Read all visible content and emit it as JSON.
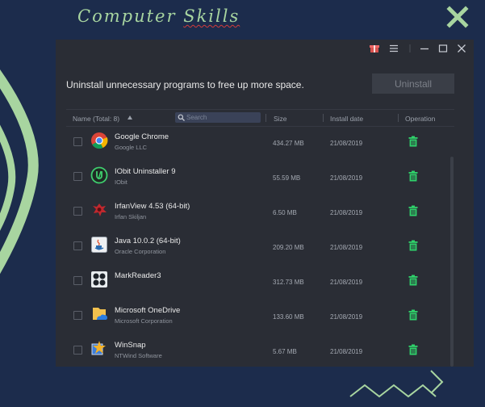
{
  "decor": {
    "title_part1": "Computer ",
    "title_part2": "Skills"
  },
  "window": {
    "headline": "Uninstall unnecessary programs to free up more space.",
    "uninstall_label": "Uninstall",
    "titlebar_icons": [
      "gift-icon",
      "menu-icon",
      "minimize-icon",
      "maximize-icon",
      "close-icon"
    ]
  },
  "columns": {
    "name": "Name (Total: 8)",
    "search_placeholder": "Search",
    "size": "Size",
    "date": "Install date",
    "operation": "Operation"
  },
  "apps": [
    {
      "name": "Google Chrome",
      "publisher": "Google LLC",
      "size": "434.27 MB",
      "date": "21/08/2019",
      "icon": "chrome-icon"
    },
    {
      "name": "IObit Uninstaller 9",
      "publisher": "IObit",
      "size": "55.59 MB",
      "date": "21/08/2019",
      "icon": "iobit-uninstaller-icon"
    },
    {
      "name": "IrfanView 4.53 (64-bit)",
      "publisher": "Irfan Skiljan",
      "size": "6.50 MB",
      "date": "21/08/2019",
      "icon": "irfanview-icon"
    },
    {
      "name": "Java 10.0.2 (64-bit)",
      "publisher": "Oracle Corporation",
      "size": "209.20 MB",
      "date": "21/08/2019",
      "icon": "java-icon"
    },
    {
      "name": "MarkReader3",
      "publisher": "",
      "size": "312.73 MB",
      "date": "21/08/2019",
      "icon": "markreader-icon"
    },
    {
      "name": "Microsoft OneDrive",
      "publisher": "Microsoft Corporation",
      "size": "133.60 MB",
      "date": "21/08/2019",
      "icon": "onedrive-icon"
    },
    {
      "name": "WinSnap",
      "publisher": "NTWind Software",
      "size": "5.67 MB",
      "date": "21/08/2019",
      "icon": "winsnap-icon"
    }
  ],
  "colors": {
    "background": "#1c2c4c",
    "accent_green": "#a8d5a0",
    "trash_green": "#2fd36b",
    "window": "#2a2d35"
  }
}
